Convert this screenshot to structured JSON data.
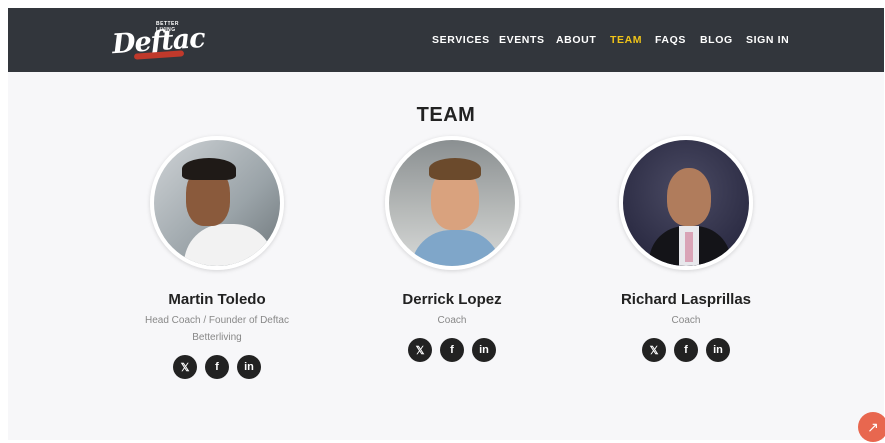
{
  "header": {
    "logo": {
      "tagline": "BETTER LIVING",
      "brand": "Deftac"
    },
    "nav": [
      {
        "label": "SERVICES",
        "active": false
      },
      {
        "label": "EVENTS",
        "active": false
      },
      {
        "label": "ABOUT",
        "active": false
      },
      {
        "label": "TEAM",
        "active": true
      },
      {
        "label": "FAQS",
        "active": false
      },
      {
        "label": "BLOG",
        "active": false
      },
      {
        "label": "SIGN IN",
        "active": false
      }
    ]
  },
  "team": {
    "title": "TEAM",
    "members": [
      {
        "name": "Martin Toledo",
        "role_line1": "Head Coach / Founder of Deftac",
        "role_line2": "Betterliving",
        "socials": [
          "twitter-icon",
          "facebook-icon",
          "linkedin-icon"
        ]
      },
      {
        "name": "Derrick Lopez",
        "role_line1": "Coach",
        "role_line2": "",
        "socials": [
          "twitter-icon",
          "facebook-icon",
          "linkedin-icon"
        ]
      },
      {
        "name": "Richard Lasprillas",
        "role_line1": "Coach",
        "role_line2": "",
        "socials": [
          "twitter-icon",
          "facebook-icon",
          "linkedin-icon"
        ]
      }
    ]
  },
  "colors": {
    "nav_bg": "#32363c",
    "accent": "#f0c419",
    "scroll_button": "#e8674f"
  },
  "icons": {
    "social_glyphs": {
      "twitter": "🐦",
      "facebook": "f",
      "linkedin": "in"
    },
    "scroll_top": "↗"
  }
}
